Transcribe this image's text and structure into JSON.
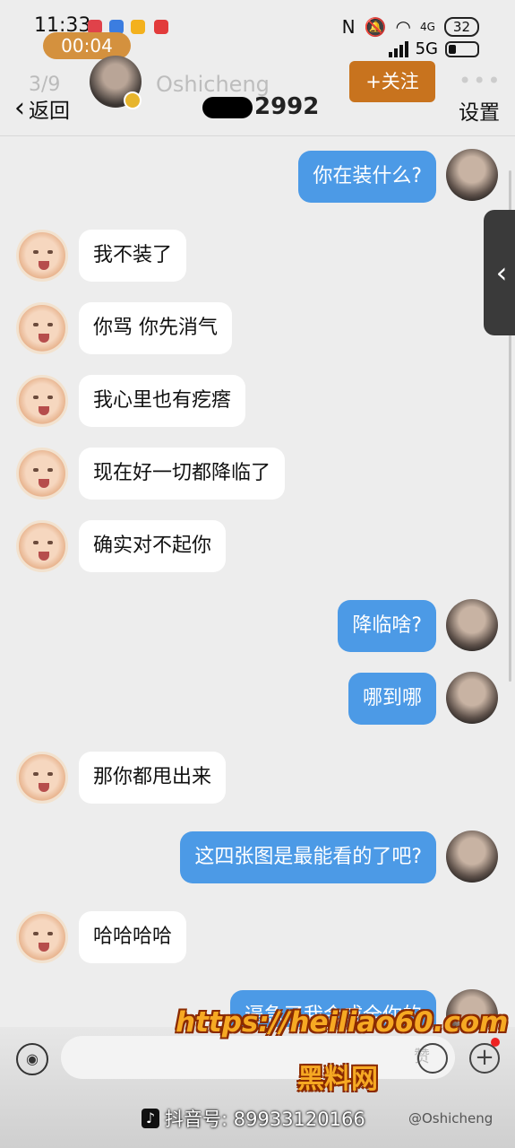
{
  "status_bar": {
    "time": "11:33",
    "timer": "00:04",
    "network": "5G",
    "network_small": "4G",
    "battery": "32"
  },
  "header": {
    "page_count": "3/9",
    "back_label": "返回",
    "nickname": "Oshicheng",
    "chat_title": "2992",
    "follow_label": "+关注",
    "more_label": "•••",
    "settings_label": "设置"
  },
  "messages": [
    {
      "side": "out",
      "text": "你在装什么?"
    },
    {
      "side": "in",
      "text": "我不装了"
    },
    {
      "side": "in",
      "text": "你骂 你先消气"
    },
    {
      "side": "in",
      "text": "我心里也有疙瘩"
    },
    {
      "side": "in",
      "text": "现在好一切都降临了"
    },
    {
      "side": "in",
      "text": "确实对不起你"
    },
    {
      "side": "out",
      "text": "降临啥?"
    },
    {
      "side": "out",
      "text": "哪到哪"
    },
    {
      "side": "in",
      "text": "那你都甩出来"
    },
    {
      "side": "out",
      "text": "这四张图是最能看的了吧?"
    },
    {
      "side": "in",
      "text": "哈哈哈哈"
    },
    {
      "side": "out",
      "text": "逼急了我会成全你的"
    }
  ],
  "input_bar": {
    "placeholder": "",
    "like_label": "赞"
  },
  "watermarks": {
    "site": "https://heiliao60.com",
    "site_name": "黑料网",
    "douyin": "抖音号: 89933120166",
    "weibo": "@Oshicheng"
  },
  "colors": {
    "outgoing_bubble": "#4c9ae6",
    "incoming_bubble": "#ffffff",
    "follow_button": "#c8731e"
  }
}
